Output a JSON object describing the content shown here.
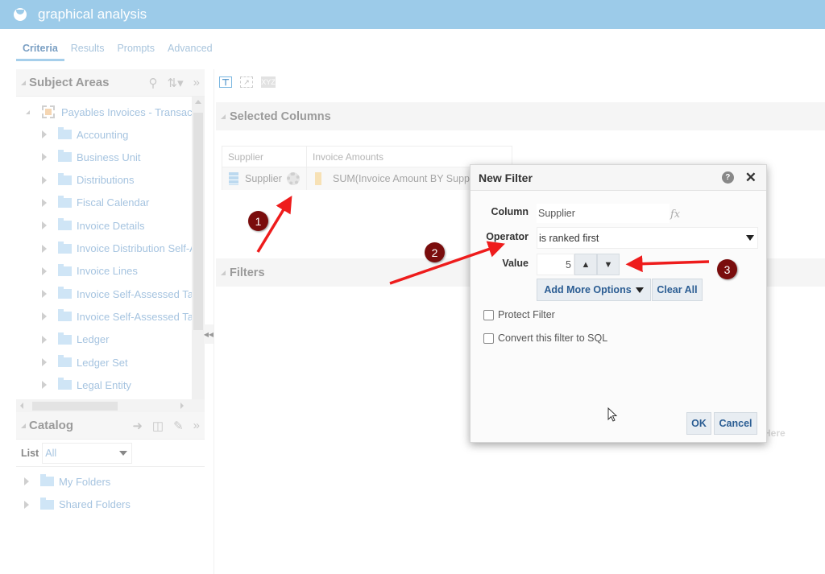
{
  "titlebar": {
    "title": "graphical analysis",
    "icon": "analysis-icon"
  },
  "tabs": [
    {
      "label": "Criteria",
      "active": true
    },
    {
      "label": "Results",
      "active": false
    },
    {
      "label": "Prompts",
      "active": false
    },
    {
      "label": "Advanced",
      "active": false
    }
  ],
  "subject_areas": {
    "title": "Subject Areas",
    "tools": [
      "search-icon",
      "sort-icon",
      "expand-panel-icon"
    ],
    "root": "Payables Invoices - Transac",
    "items": [
      "Accounting",
      "Business Unit",
      "Distributions",
      "Fiscal Calendar",
      "Invoice Details",
      "Invoice Distribution Self-A",
      "Invoice Lines",
      "Invoice Self-Assessed Ta",
      "Invoice Self-Assessed Ta",
      "Ledger",
      "Ledger Set",
      "Legal Entity"
    ]
  },
  "catalog": {
    "title": "Catalog",
    "tools": [
      "arrow-right-icon",
      "properties-icon",
      "edit-icon",
      "expand-panel-icon"
    ],
    "list_label": "List",
    "list_value": "All",
    "items": [
      "My Folders",
      "Shared Folders"
    ]
  },
  "toolbar": {
    "icons": [
      "filter-icon",
      "chart-icon",
      "xyz-icon"
    ],
    "xyz_label": "XYZ"
  },
  "selected_columns": {
    "title": "Selected Columns",
    "headers": [
      "Supplier",
      "Invoice Amounts"
    ],
    "cells": [
      "Supplier",
      "SUM(Invoice Amount BY Supp"
    ]
  },
  "filters": {
    "title": "Filters",
    "drop_hint": "Here"
  },
  "dialog": {
    "title": "New Filter",
    "column_label": "Column",
    "column_value": "Supplier",
    "fx_label": "fx",
    "operator_label": "Operator",
    "operator_value": "is ranked first",
    "value_label": "Value",
    "value": "5",
    "up_label": "^",
    "down_label": "v",
    "add_more_label": "Add More Options",
    "clear_all_label": "Clear All",
    "protect_label": "Protect Filter",
    "protect_checked": false,
    "sql_label": "Convert this filter to SQL",
    "sql_checked": false,
    "ok_label": "OK",
    "cancel_label": "Cancel",
    "help_label": "?",
    "close_label": "✕"
  },
  "annotations": [
    {
      "number": "1"
    },
    {
      "number": "2"
    },
    {
      "number": "3"
    }
  ],
  "colors": {
    "titlebar": "#9ccbe9",
    "annotation_badge": "#7a0d0d",
    "annotation_arrow": "#ee1c1c",
    "button_text": "#2b5d93"
  }
}
